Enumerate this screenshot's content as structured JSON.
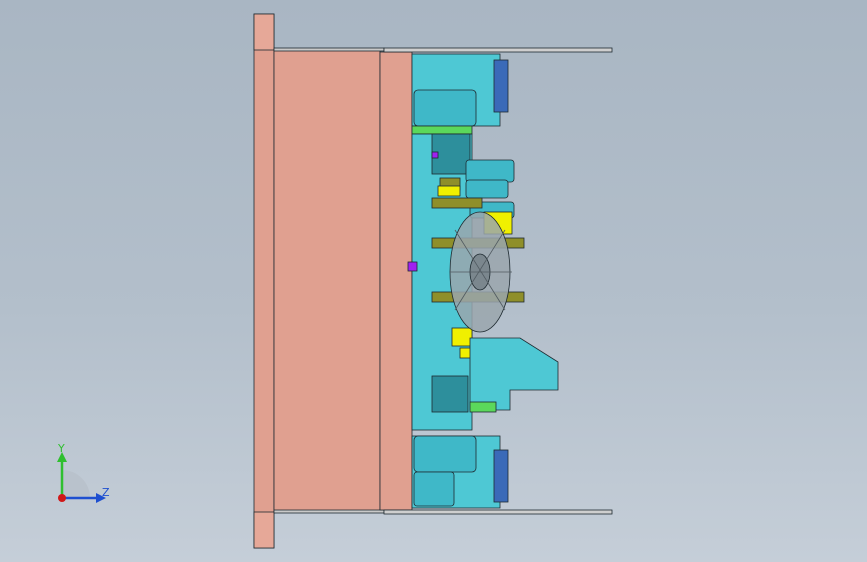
{
  "viewport": {
    "background_top": "#a9b6c3",
    "background_bottom": "#c5ced8"
  },
  "model": {
    "colors": {
      "clamp_plate": "#e0a090",
      "cavity_plate": "#e0a090",
      "cyan_parts": "#4ec8d4",
      "cyan_dark": "#2d8f9c",
      "cylinder": "#3fb8c8",
      "olive_parts": "#8f8f2a",
      "yellow_parts": "#f0f000",
      "green_parts": "#5bd85b",
      "purple_marker": "#a020f0",
      "fan": "#9aa6ad",
      "outline": "#1e2a30"
    }
  },
  "triad": {
    "y_label": "Y",
    "z_label": "Z",
    "y_color": "#2fbf2f",
    "z_color": "#1e4fd0",
    "origin_color": "#d01818"
  }
}
